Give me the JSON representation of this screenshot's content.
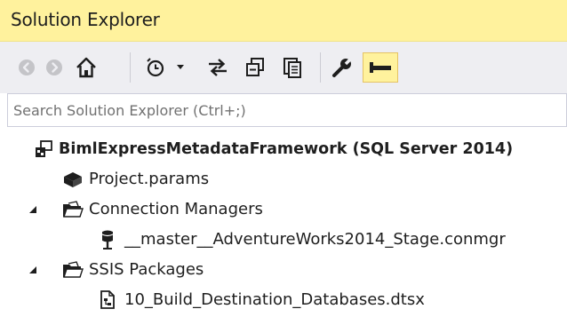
{
  "window": {
    "title": "Solution Explorer"
  },
  "toolbar": {
    "buttons": [
      {
        "name": "back-icon"
      },
      {
        "name": "forward-icon"
      },
      {
        "name": "home-icon"
      },
      {
        "name": "pending-changes-filter-icon"
      },
      {
        "name": "sync-with-active-document-icon"
      },
      {
        "name": "collapse-all-icon"
      },
      {
        "name": "show-all-files-icon"
      },
      {
        "name": "properties-wrench-icon"
      },
      {
        "name": "preview-selected-items-icon"
      }
    ]
  },
  "search": {
    "placeholder": "Search Solution Explorer (Ctrl+;)"
  },
  "tree": {
    "root": {
      "label": "BimlExpressMetadataFramework (SQL Server 2014)",
      "icon": "ssis-project-icon"
    },
    "items": [
      {
        "label": "Project.params",
        "icon": "params-icon"
      },
      {
        "label": "Connection Managers",
        "icon": "folder-icon",
        "expanded": true
      },
      {
        "label": "__master__AdventureWorks2014_Stage.conmgr",
        "icon": "database-icon"
      },
      {
        "label": "SSIS Packages",
        "icon": "folder-icon",
        "expanded": true
      },
      {
        "label": "10_Build_Destination_Databases.dtsx",
        "icon": "package-file-icon"
      }
    ]
  },
  "colors": {
    "title_bar": "#fff29d",
    "toolbar": "#eeeef2",
    "active_button": "#fff29d"
  }
}
